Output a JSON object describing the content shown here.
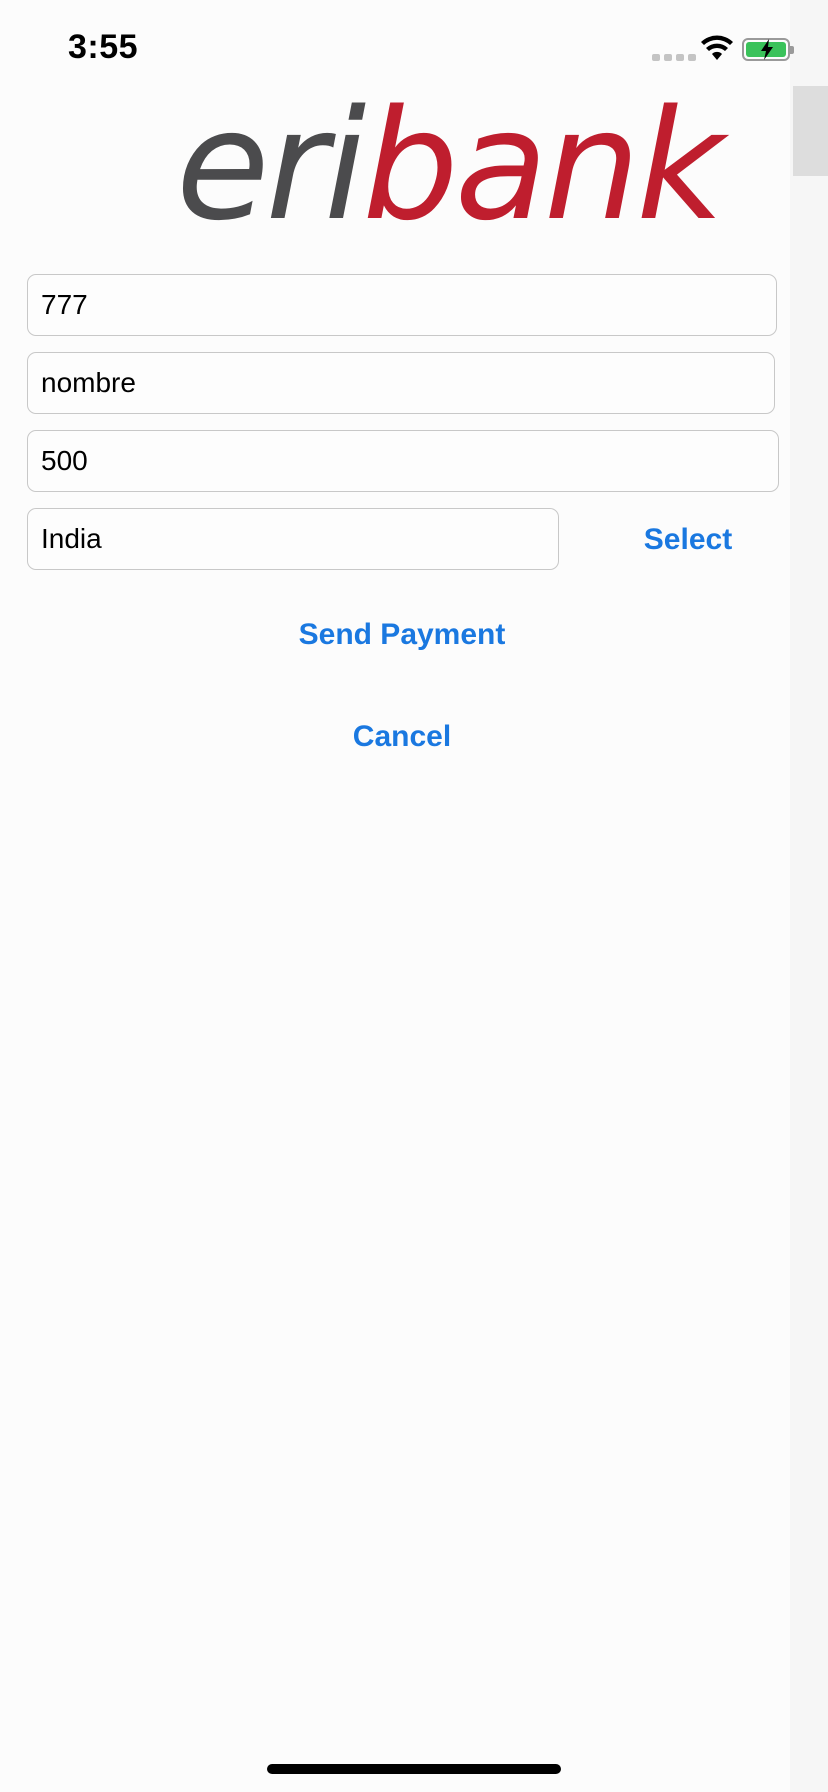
{
  "status_bar": {
    "time": "3:55",
    "battery_color": "#3ac25a"
  },
  "logo": {
    "part1": "eri",
    "part2": "bank",
    "part1_color": "#4b4b4d",
    "part2_color": "#bf1e2e"
  },
  "form": {
    "account_value": "777",
    "name_value": "nombre",
    "amount_value": "500",
    "country_value": "India",
    "select_label": "Select"
  },
  "actions": {
    "send_label": "Send Payment",
    "cancel_label": "Cancel",
    "accent": "#1a78e0"
  }
}
